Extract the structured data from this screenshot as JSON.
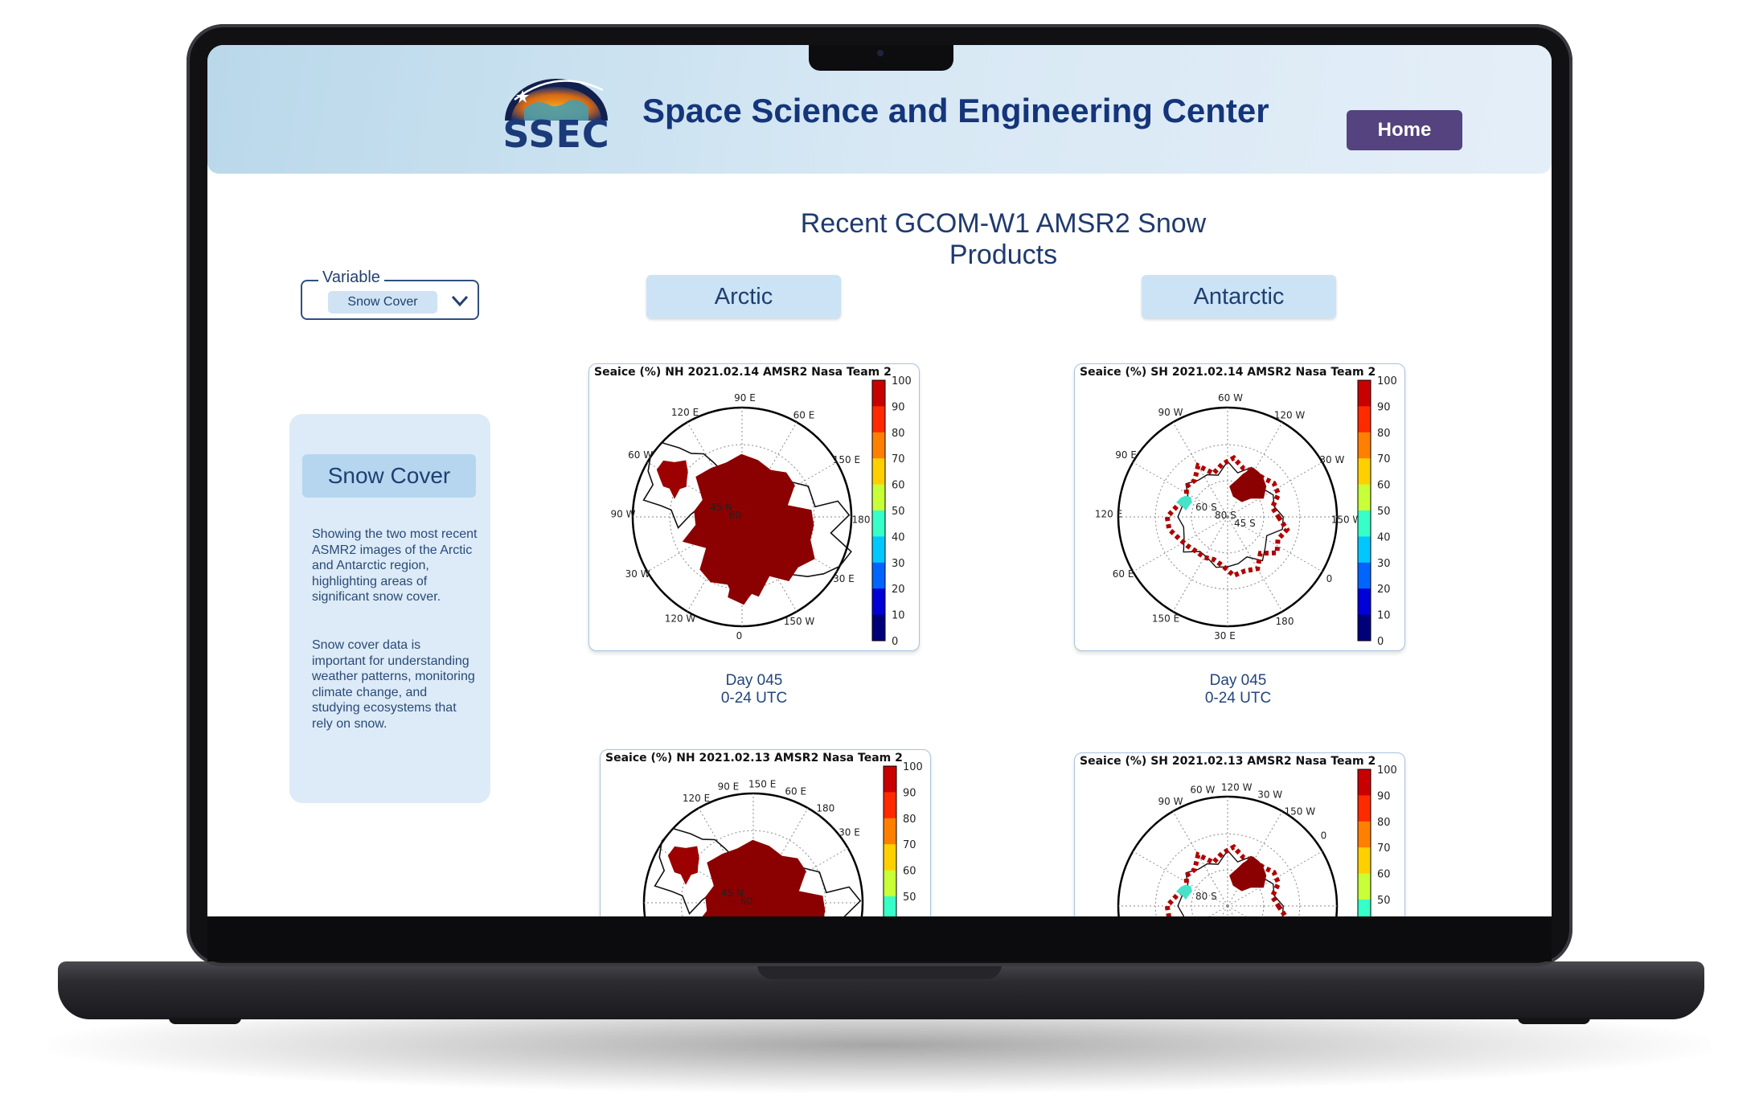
{
  "header": {
    "logo_text": "SSEC",
    "title": "Space Science and Engineering Center",
    "home_label": "Home"
  },
  "page": {
    "heading": "Recent GCOM-W1 AMSR2 Snow Products"
  },
  "variable_select": {
    "legend": "Variable",
    "selected": "Snow Cover"
  },
  "side_card": {
    "button_label": "Snow Cover",
    "description_1": "Showing the two most recent ASMR2 images of the Arctic and Antarctic region, highlighting areas of significant snow cover.",
    "description_2": "Snow cover data is important for understanding weather patterns, monitoring climate change, and studying ecosystems that rely on snow."
  },
  "regions": {
    "arctic": "Arctic",
    "antarctic": "Antarctic"
  },
  "maps": {
    "nh_0214": {
      "title": "Seaice (%) NH 2021.02.14 AMSR2 Nasa Team 2",
      "lon_labels": [
        "120 E",
        "90 E",
        "60 E",
        "150 E",
        "180",
        "30 E",
        "150 W",
        "0",
        "120 W",
        "30 W",
        "90 W",
        "60 W"
      ],
      "lat_labels": [
        "45 N",
        "60"
      ],
      "colorbar": [
        "100",
        "90",
        "80",
        "70",
        "60",
        "50",
        "40",
        "30",
        "20",
        "10",
        "0"
      ]
    },
    "sh_0214": {
      "title": "Seaice (%) SH 2021.02.14 AMSR2 Nasa Team 2",
      "lon_labels": [
        "90 W",
        "60 W",
        "120 W",
        "30 W",
        "150 W",
        "0",
        "180",
        "30 E",
        "150 E",
        "60 E",
        "120 E",
        "90 E"
      ],
      "lat_labels": [
        "60 S",
        "80 S",
        "45 S"
      ],
      "colorbar": [
        "100",
        "90",
        "80",
        "70",
        "60",
        "50",
        "40",
        "30",
        "20",
        "10",
        "0"
      ]
    },
    "nh_0213": {
      "title": "Seaice (%) NH 2021.02.13 AMSR2 Nasa Team 2",
      "lon_labels": [
        "120 E",
        "90 E",
        "150 E",
        "60 E",
        "180",
        "30 E"
      ],
      "lat_labels": [
        "45 N",
        "60"
      ],
      "colorbar": [
        "100",
        "90",
        "80",
        "70",
        "60",
        "50"
      ]
    },
    "sh_0213": {
      "title": "Seaice (%) SH 2021.02.13 AMSR2 Nasa Team 2",
      "lon_labels": [
        "90 W",
        "60 W",
        "120 W",
        "30 W",
        "150 W",
        "0"
      ],
      "lat_labels": [
        "80 S"
      ],
      "colorbar": [
        "100",
        "90",
        "80",
        "70",
        "60",
        "50"
      ]
    }
  },
  "captions": {
    "arctic": {
      "day": "Day 045",
      "time": "0-24 UTC"
    },
    "antarctic": {
      "day": "Day 045",
      "time": "0-24 UTC"
    }
  }
}
